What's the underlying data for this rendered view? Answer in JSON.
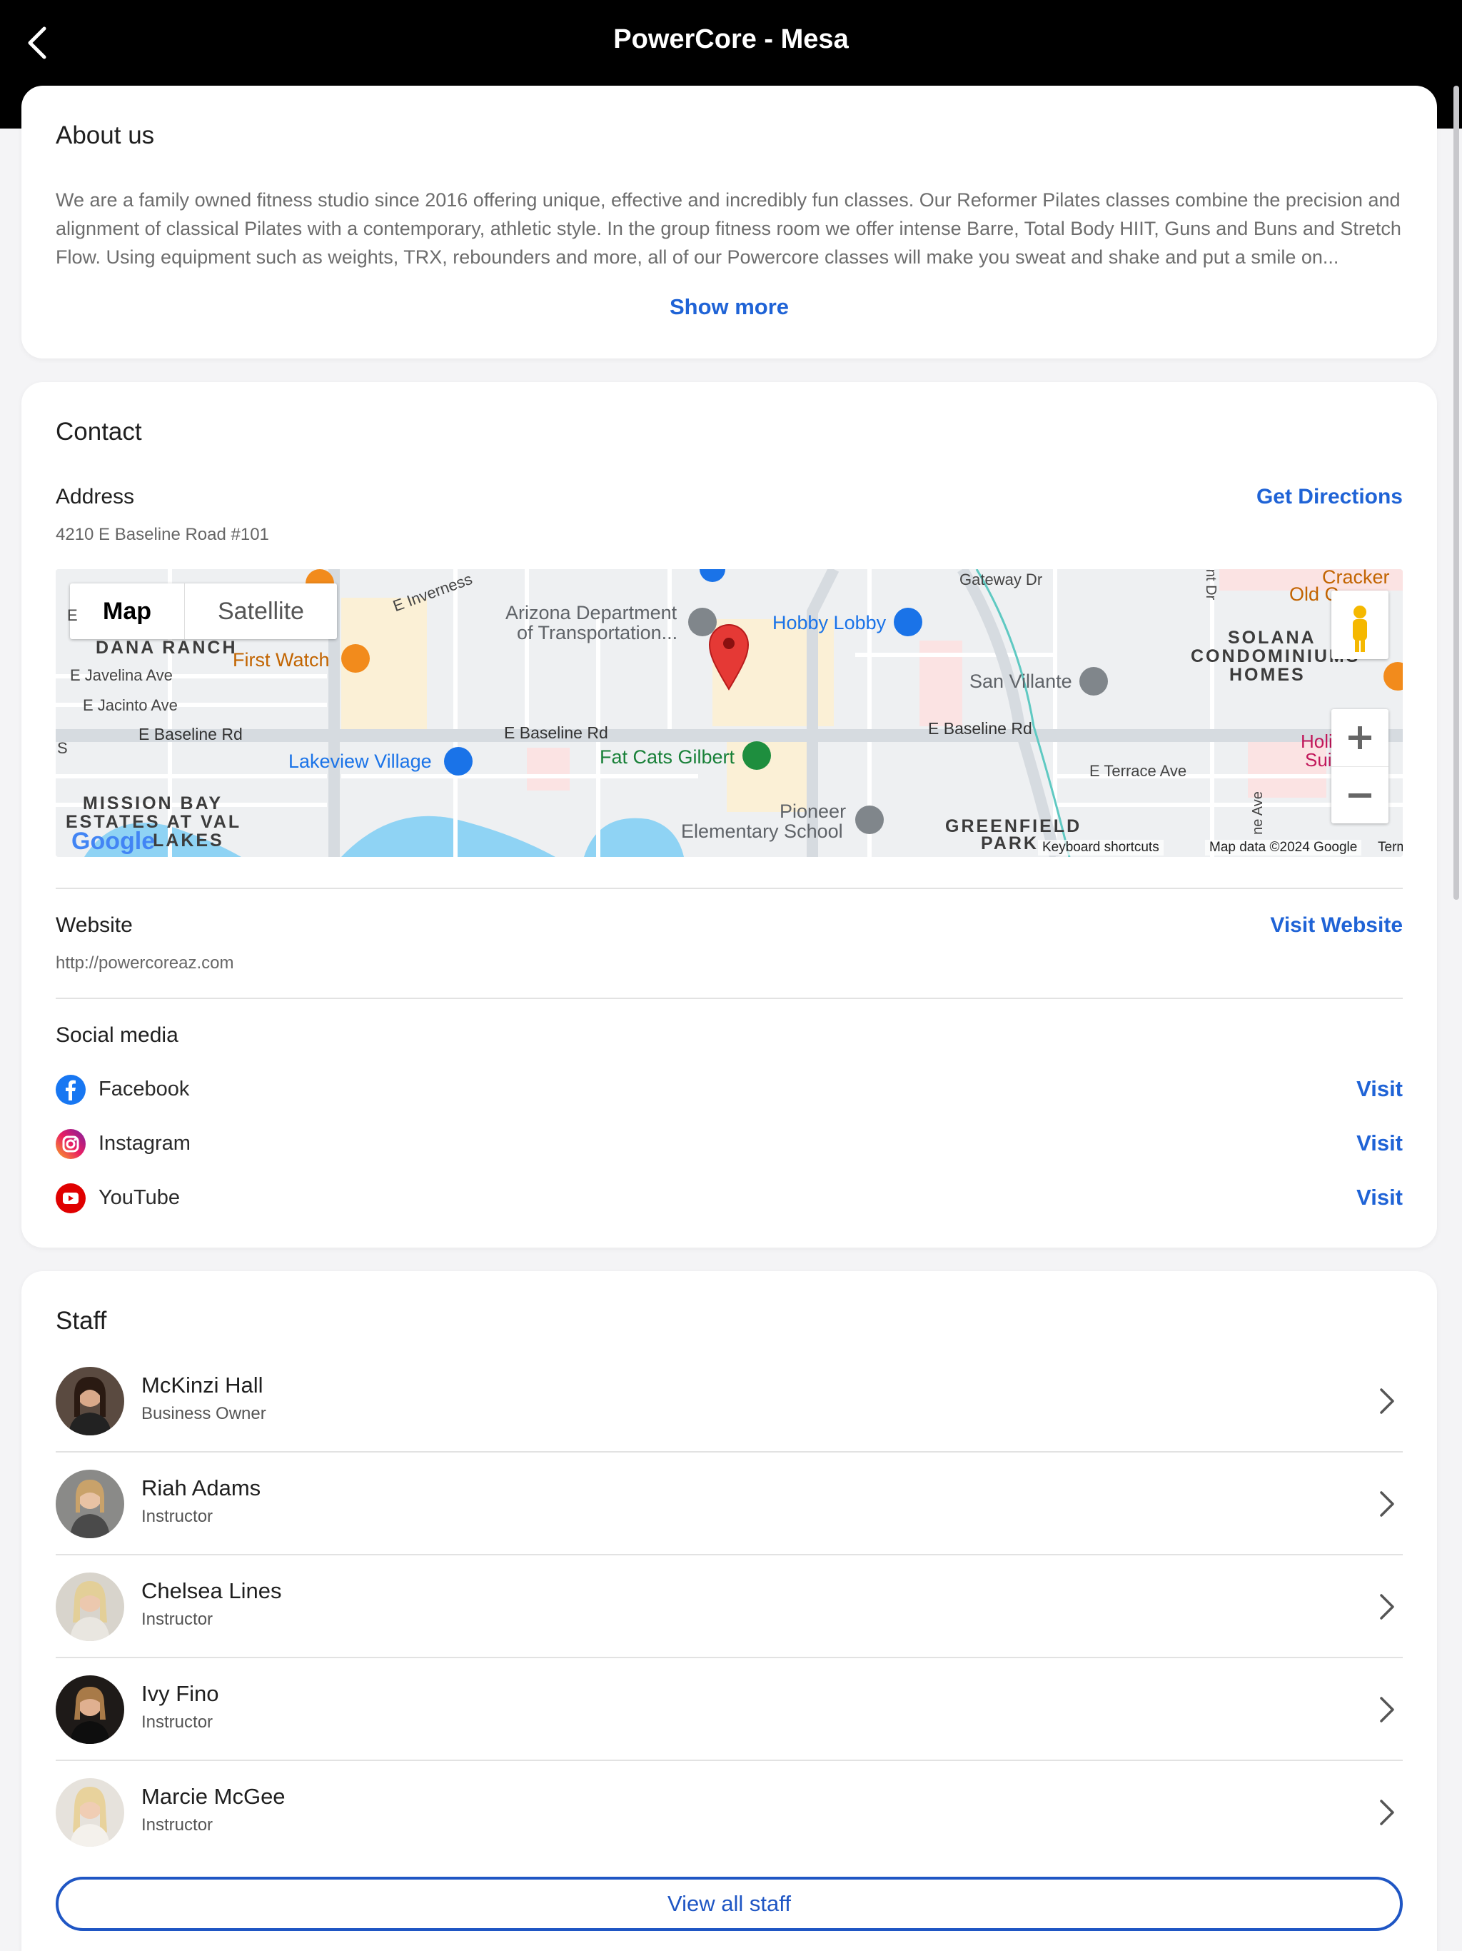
{
  "header": {
    "title": "PowerCore - Mesa",
    "back_icon": "chevron-left-icon"
  },
  "about": {
    "heading": "About us",
    "text": "We are a family owned fitness studio since 2016 offering unique, effective and incredibly fun classes.  Our Reformer Pilates classes combine the precision and alignment of classical Pilates with a contemporary, athletic style.  In the group fitness room we offer intense Barre, Total Body HIIT, Guns and Buns and Stretch Flow. Using equipment such as weights, TRX, rebounders and more, all of our Powercore classes will make you sweat and shake and put a smile on...",
    "show_more": "Show more"
  },
  "contact": {
    "heading": "Contact",
    "address_label": "Address",
    "address": "4210 E Baseline Road #101",
    "directions": "Get Directions",
    "map": {
      "toggle_map": "Map",
      "toggle_satellite": "Satellite",
      "labels": {
        "dana_ranch": "DANA RANCH",
        "javelina": "E Javelina Ave",
        "jacinto": "E Jacinto Ave",
        "baseline_w": "E Baseline Rd",
        "baseline_c": "E Baseline Rd",
        "baseline_e": "E Baseline Rd",
        "first_watch": "First Watch",
        "lakeview": "Lakeview Village",
        "azdot": "Arizona Department",
        "azdot2": "of Transportation...",
        "inverness": "E Inverness",
        "hobby_lobby": "Hobby Lobby",
        "fat_cats": "Fat Cats Gilbert",
        "san_villante": "San Villante",
        "gateway": "Gateway Dr",
        "solana1": "SOLANA",
        "solana2": "CONDOMINIUMS",
        "solana3": "HOMES",
        "cracker": "Cracker",
        "old": "Old C",
        "terrace": "E Terrace Ave",
        "pioneer1": "Pioneer",
        "pioneer2": "Elementary School",
        "greenfield1": "GREENFIELD",
        "greenfield2": "PARK",
        "mission1": "MISSION BAY",
        "mission2": "ESTATES AT VAL",
        "mission3": "LAKES",
        "holi1": "Holi",
        "holi2": "Sui",
        "s_mark": "S",
        "e_mark": "E",
        "ave_mark": "ne Ave",
        "dr_mark": "nt Dr"
      },
      "google": "Google",
      "shortcuts": "Keyboard shortcuts",
      "map_data": "Map data ©2024 Google",
      "terms": "Terms"
    },
    "website_label": "Website",
    "website": "http://powercoreaz.com",
    "visit_website": "Visit Website",
    "social_label": "Social media",
    "social": [
      {
        "name": "Facebook",
        "visit": "Visit",
        "icon": "facebook-icon",
        "color": "#1877f2"
      },
      {
        "name": "Instagram",
        "visit": "Visit",
        "icon": "instagram-icon",
        "color": "#c13584"
      },
      {
        "name": "YouTube",
        "visit": "Visit",
        "icon": "youtube-icon",
        "color": "#e00000"
      }
    ]
  },
  "staff": {
    "heading": "Staff",
    "members": [
      {
        "name": "McKinzi Hall",
        "role": "Business Owner"
      },
      {
        "name": "Riah Adams",
        "role": "Instructor"
      },
      {
        "name": "Chelsea Lines",
        "role": "Instructor"
      },
      {
        "name": "Ivy Fino",
        "role": "Instructor"
      },
      {
        "name": "Marcie McGee",
        "role": "Instructor"
      }
    ],
    "view_all": "View all staff"
  },
  "colors": {
    "accent": "#1f63d6",
    "header_bg": "#000000"
  }
}
